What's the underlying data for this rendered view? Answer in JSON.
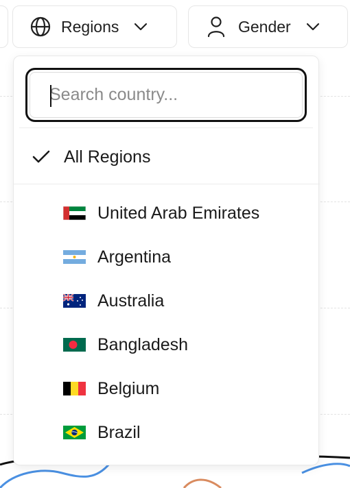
{
  "filters": {
    "regions_label": "Regions",
    "gender_label": "Gender"
  },
  "dropdown": {
    "search_placeholder": "Search country...",
    "search_value": "",
    "all_option": {
      "label": "All Regions",
      "selected": true
    },
    "countries": [
      {
        "label": "United Arab Emirates",
        "flag": "ae-flag-icon"
      },
      {
        "label": "Argentina",
        "flag": "ar-flag-icon"
      },
      {
        "label": "Australia",
        "flag": "au-flag-icon"
      },
      {
        "label": "Bangladesh",
        "flag": "bd-flag-icon"
      },
      {
        "label": "Belgium",
        "flag": "be-flag-icon"
      },
      {
        "label": "Brazil",
        "flag": "br-flag-icon"
      }
    ]
  },
  "colors": {
    "focus_ring": "#111111",
    "border": "#e6e6e6",
    "curve_blue": "#4a90e2",
    "curve_orange": "#d98b5f",
    "curve_black": "#111111"
  }
}
